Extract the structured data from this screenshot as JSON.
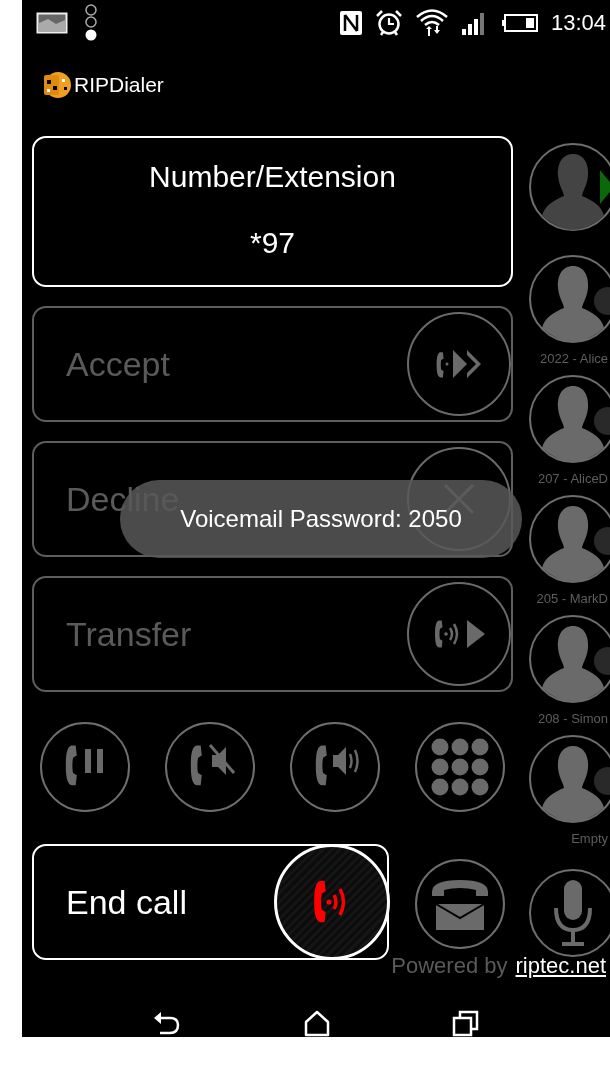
{
  "status_bar": {
    "time": "13:04"
  },
  "app": {
    "title": "RIPDialer"
  },
  "number_box": {
    "label": "Number/Extension",
    "value": "*97"
  },
  "actions": [
    {
      "label": "Accept",
      "kind": "accept",
      "disabled": true
    },
    {
      "label": "Decline",
      "kind": "decline",
      "disabled": true
    },
    {
      "label": "Transfer",
      "kind": "transfer",
      "disabled": true
    }
  ],
  "call_controls": [
    {
      "kind": "hold"
    },
    {
      "kind": "mute"
    },
    {
      "kind": "speaker"
    },
    {
      "kind": "keypad"
    }
  ],
  "end_call": {
    "label": "End call"
  },
  "voicemail_button": {
    "kind": "voicemail"
  },
  "contacts": [
    {
      "active": true
    },
    {
      "label": "2022 - Alice",
      "active": false
    },
    {
      "label": "207 - AliceD",
      "active": false
    },
    {
      "label": "205 - MarkD",
      "active": false
    },
    {
      "label": "208 - Simon",
      "active": false
    },
    {
      "label": "Empty",
      "active": false
    }
  ],
  "microphone_button": {
    "kind": "microphone"
  },
  "toast": {
    "text": "Voicemail Password: 2050"
  },
  "footer": {
    "text": "Powered by",
    "link": "riptec.net"
  },
  "nav_bar": [
    {
      "kind": "back"
    },
    {
      "kind": "home"
    },
    {
      "kind": "recents"
    }
  ]
}
